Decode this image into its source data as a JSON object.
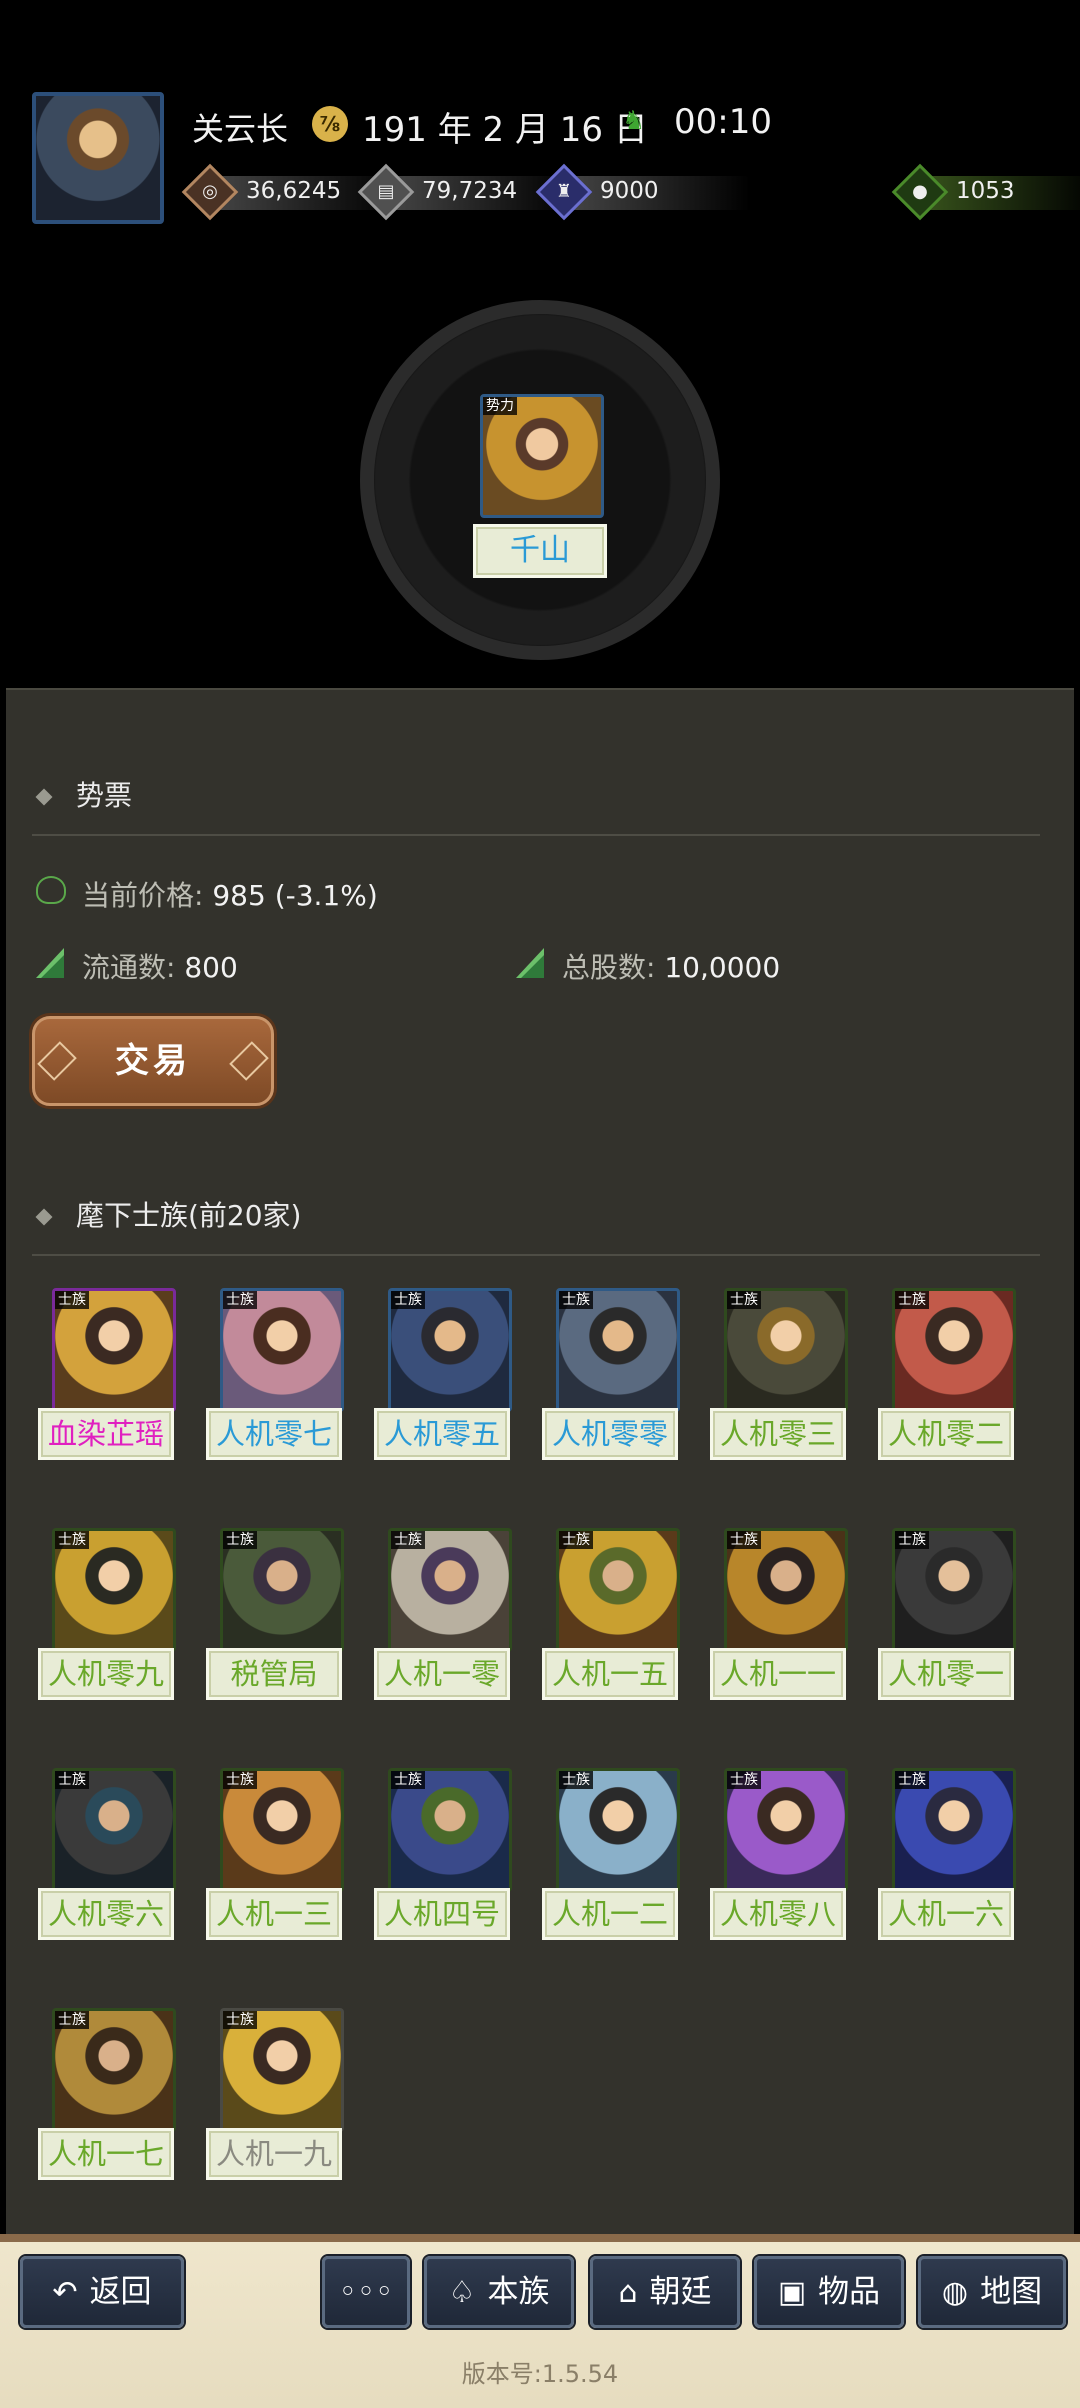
{
  "header": {
    "player_name": "关云长",
    "date_icon": "calendar-seal-icon",
    "game_date": "191 年 2 月 16 日",
    "speed_icon": "horse-icon",
    "game_time": "00:10",
    "resources": [
      {
        "icon": "coin-bag-icon",
        "value": "36,6245"
      },
      {
        "icon": "scroll-icon",
        "value": "79,7234"
      },
      {
        "icon": "soldier-icon",
        "value": "9000"
      },
      {
        "icon": "grain-sack-icon",
        "value": "1053"
      }
    ]
  },
  "force": {
    "tag": "势力",
    "name": "千山"
  },
  "stock": {
    "section_title": "势票",
    "price_label": "当前价格:",
    "price_value": "985 (-3.1%)",
    "circulation_label": "流通数:",
    "circulation_value": "800",
    "total_label": "总股数:",
    "total_value": "10,0000",
    "trade_button": "交易"
  },
  "clans": {
    "section_title": "麾下士族(前20家)",
    "tag": "士族",
    "items": [
      {
        "name": "血染芷瑶",
        "color": "#e020c0"
      },
      {
        "name": "人机零七",
        "color": "#2a9ad6"
      },
      {
        "name": "人机零五",
        "color": "#2a9ad6"
      },
      {
        "name": "人机零零",
        "color": "#2a9ad6"
      },
      {
        "name": "人机零三",
        "color": "#6aa82a"
      },
      {
        "name": "人机零二",
        "color": "#6aa82a"
      },
      {
        "name": "人机零九",
        "color": "#6aa82a"
      },
      {
        "name": "税管局",
        "color": "#6aa82a"
      },
      {
        "name": "人机一零",
        "color": "#6aa82a"
      },
      {
        "name": "人机一五",
        "color": "#6aa82a"
      },
      {
        "name": "人机一一",
        "color": "#6aa82a"
      },
      {
        "name": "人机零一",
        "color": "#6aa82a"
      },
      {
        "name": "人机零六",
        "color": "#6aa82a"
      },
      {
        "name": "人机一三",
        "color": "#6aa82a"
      },
      {
        "name": "人机四号",
        "color": "#6aa82a"
      },
      {
        "name": "人机一二",
        "color": "#6aa82a"
      },
      {
        "name": "人机零八",
        "color": "#6aa82a"
      },
      {
        "name": "人机一六",
        "color": "#6aa82a"
      },
      {
        "name": "人机一七",
        "color": "#6aa82a"
      },
      {
        "name": "人机一九",
        "color": "#8a8a80"
      }
    ]
  },
  "nav": {
    "back": "返回",
    "more": "◦◦◦",
    "clan": "本族",
    "court": "朝廷",
    "items": "物品",
    "map": "地图"
  },
  "version": "版本号:1.5.54"
}
